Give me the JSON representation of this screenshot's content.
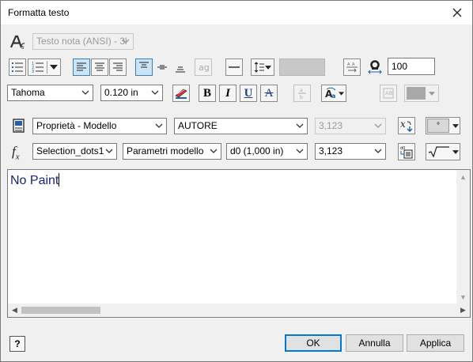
{
  "window": {
    "title": "Formatta testo"
  },
  "toolbar1": {
    "style_combo": "Testo nota (ANSI) - 3l"
  },
  "toolbar2": {
    "width_value": "100"
  },
  "toolbar3": {
    "font": "Tahoma",
    "size": "0.120 in",
    "bold_label": "B",
    "italic_label": "I",
    "underline_label": "U",
    "strike_label": "A"
  },
  "row4": {
    "type_combo": "Proprietà - Modello",
    "property_combo": "AUTORE",
    "precision_combo": "3,123",
    "symbol_value": "°"
  },
  "row5": {
    "fx_label": "f",
    "fx_sub": "x",
    "param_source": "Selection_dots1",
    "param_type": "Parametri modello",
    "param_name": "d0 (1,000 in)",
    "param_precision": "3,123"
  },
  "editor": {
    "text": "No Paint"
  },
  "buttons": {
    "ok": "OK",
    "cancel": "Annulla",
    "apply": "Applica",
    "help": "?"
  }
}
